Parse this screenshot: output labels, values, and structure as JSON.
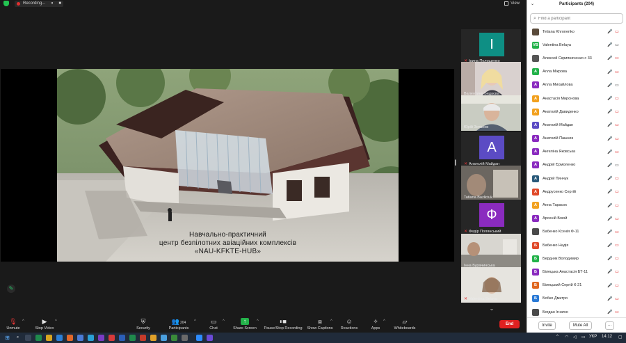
{
  "top_bar": {
    "recording_label": "Recording...",
    "pause_glyph": "⏸",
    "stop_glyph": "■",
    "view_label": "View"
  },
  "slide": {
    "caption_lines": [
      "Навчально-практичний",
      "центр безпілотних авіаційних комплексів",
      "«NAU-KFKTE-HUB»"
    ]
  },
  "video_tiles": [
    {
      "name": "Ірина Полощенко",
      "type": "avatar",
      "initial": "I",
      "color": "#0e8f84",
      "muted": true,
      "active": false
    },
    {
      "name": "Валентина Бедаєва",
      "type": "photo",
      "muted": false,
      "active": false
    },
    {
      "name": "Юрій Зотанов",
      "type": "photo",
      "muted": false,
      "active": true
    },
    {
      "name": "Анатолій Майдан",
      "type": "avatar",
      "initial": "A",
      "color": "#5b4bc4",
      "muted": true,
      "active": false
    },
    {
      "name": "Tatiana Bazliciuk",
      "type": "photo",
      "muted": false,
      "active": false
    },
    {
      "name": "Федір Полянський",
      "type": "avatar",
      "initial": "Ф",
      "color": "#8a2bbf",
      "muted": true,
      "active": false
    },
    {
      "name": "Інна Бурачинська",
      "type": "photo",
      "muted": false,
      "active": false
    },
    {
      "name": "Valentina Belaya",
      "type": "photo",
      "muted": true,
      "active": false
    }
  ],
  "toolbar": {
    "unmute": "Unmute",
    "stop_video": "Stop Video",
    "security": "Security",
    "participants": "Participants",
    "participants_count": "204",
    "chat": "Chat",
    "share_screen": "Share Screen",
    "pause_stop_recording": "Pause/Stop Recording",
    "show_captions": "Show Captions",
    "reactions": "Reactions",
    "apps": "Apps",
    "whiteboards": "Whiteboards",
    "end": "End"
  },
  "panel": {
    "title": "Participants (204)",
    "search_placeholder": "Find a participant",
    "invite": "Invite",
    "mute_all": "Mute All",
    "more": "···",
    "participants": [
      {
        "name": "Tetiana Khronenko",
        "initial": "",
        "color": "#5a4a3a",
        "photo": true,
        "cam_off": true
      },
      {
        "name": "Valentina Belaya",
        "initial": "VB",
        "color": "#23b24a",
        "photo": false,
        "cam_off": false
      },
      {
        "name": "Алексей Скрипниченко с 33",
        "initial": "",
        "color": "#555555",
        "photo": true,
        "cam_off": true
      },
      {
        "name": "Алла Мікрова",
        "initial": "A",
        "color": "#23b24a",
        "photo": false,
        "cam_off": true
      },
      {
        "name": "Алла Михайлова",
        "initial": "A",
        "color": "#8a2bbf",
        "photo": false,
        "cam_off": false
      },
      {
        "name": "Анастасія Миронова",
        "initial": "A",
        "color": "#f2a11f",
        "photo": false,
        "cam_off": true
      },
      {
        "name": "Анатолій Давиденко",
        "initial": "A",
        "color": "#f2a11f",
        "photo": false,
        "cam_off": true
      },
      {
        "name": "Анатолій Майдан",
        "initial": "A",
        "color": "#5b4bc4",
        "photo": false,
        "cam_off": true
      },
      {
        "name": "Анатолій Пашник",
        "initial": "A",
        "color": "#8a2bbf",
        "photo": false,
        "cam_off": true
      },
      {
        "name": "Ангеліна Яковська",
        "initial": "A",
        "color": "#8a2bbf",
        "photo": false,
        "cam_off": true
      },
      {
        "name": "Андрій Єрмоленко",
        "initial": "A",
        "color": "#8a2bbf",
        "photo": false,
        "cam_off": false
      },
      {
        "name": "Андрій Пинчук",
        "initial": "A",
        "color": "#2a5a7a",
        "photo": false,
        "cam_off": true
      },
      {
        "name": "Андрусенко Сергій",
        "initial": "A",
        "color": "#e04a2a",
        "photo": false,
        "cam_off": true
      },
      {
        "name": "Анна Тарасок",
        "initial": "A",
        "color": "#f2a11f",
        "photo": false,
        "cam_off": true
      },
      {
        "name": "Арсеній Боюй",
        "initial": "A",
        "color": "#8a2bbf",
        "photo": false,
        "cam_off": true
      },
      {
        "name": "Бабенко Ксенія Ф-11",
        "initial": "",
        "color": "#4a4a4a",
        "photo": true,
        "cam_off": true
      },
      {
        "name": "Бабенко Надія",
        "initial": "Б",
        "color": "#e04a2a",
        "photo": false,
        "cam_off": true
      },
      {
        "name": "Бердник Володимир",
        "initial": "Б",
        "color": "#23b24a",
        "photo": false,
        "cam_off": true
      },
      {
        "name": "Білецька Анастасія БТ-11",
        "initial": "Б",
        "color": "#8a2bbf",
        "photo": false,
        "cam_off": true
      },
      {
        "name": "Білецький Сергій К-21",
        "initial": "Б",
        "color": "#e0671f",
        "photo": false,
        "cam_off": true
      },
      {
        "name": "Бобко Дмитро",
        "initial": "Б",
        "color": "#2a7ad6",
        "photo": false,
        "cam_off": true
      },
      {
        "name": "Богдан Ігнатко",
        "initial": "",
        "color": "#4a4a4a",
        "photo": true,
        "cam_off": true
      }
    ]
  },
  "taskbar": {
    "language": "УКР",
    "time": "14:12"
  }
}
